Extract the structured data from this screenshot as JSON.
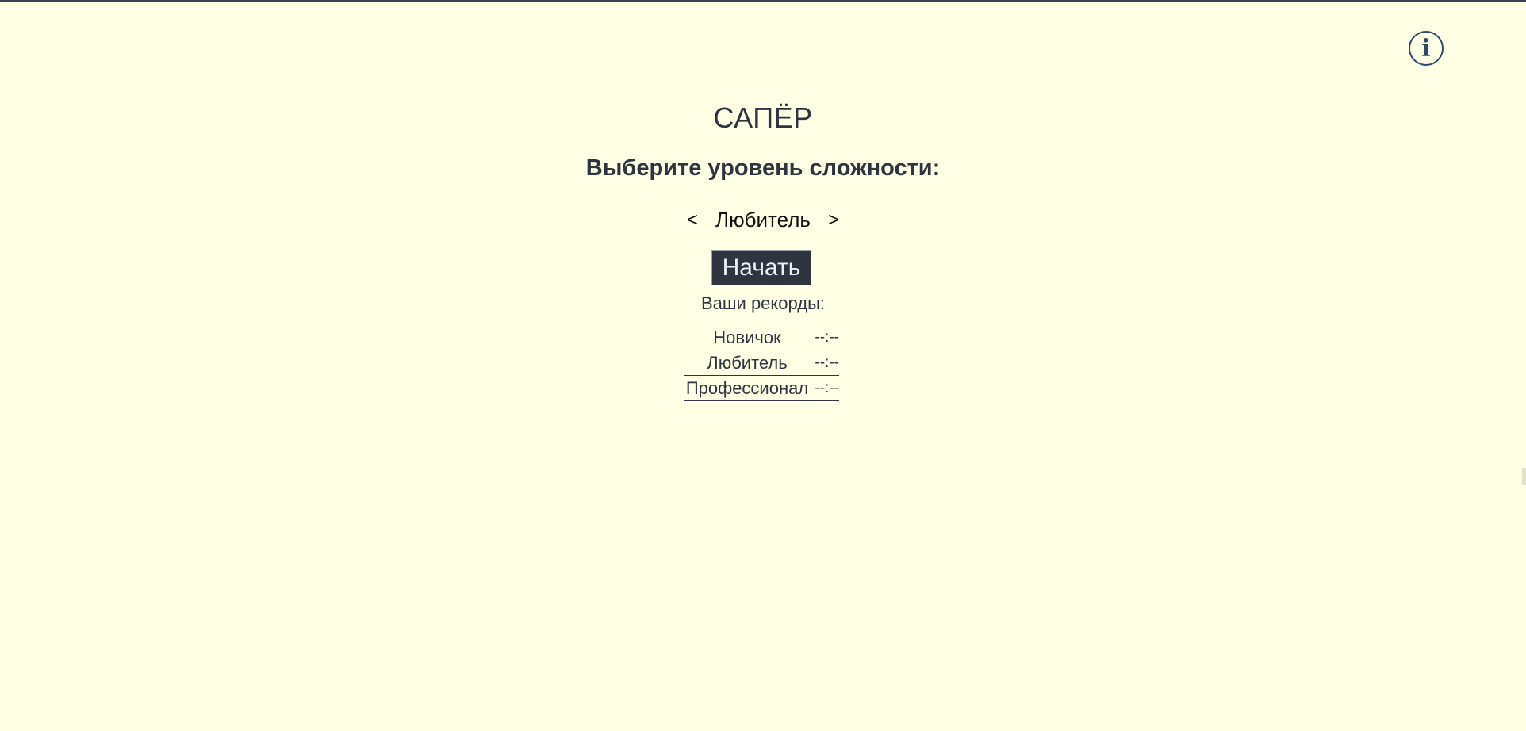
{
  "app": {
    "title": "САПЁР",
    "subtitle": "Выберите уровень сложности:"
  },
  "info_button": {
    "glyph": "i",
    "icon": "info-icon"
  },
  "level_selector": {
    "prev_label": "<",
    "current_level": "Любитель",
    "next_label": ">"
  },
  "start_button": {
    "label": "Начать"
  },
  "records": {
    "title": "Ваши рекорды:",
    "rows": [
      {
        "level": "Новичок",
        "time": "--:--"
      },
      {
        "level": "Любитель",
        "time": "--:--"
      },
      {
        "level": "Профессионал",
        "time": "--:--"
      }
    ]
  },
  "colors": {
    "background": "#ffffe6",
    "text": "#2e3440",
    "button_bg": "#2e3440",
    "button_text": "#eceff4",
    "info_accent": "#2e4a6b"
  }
}
